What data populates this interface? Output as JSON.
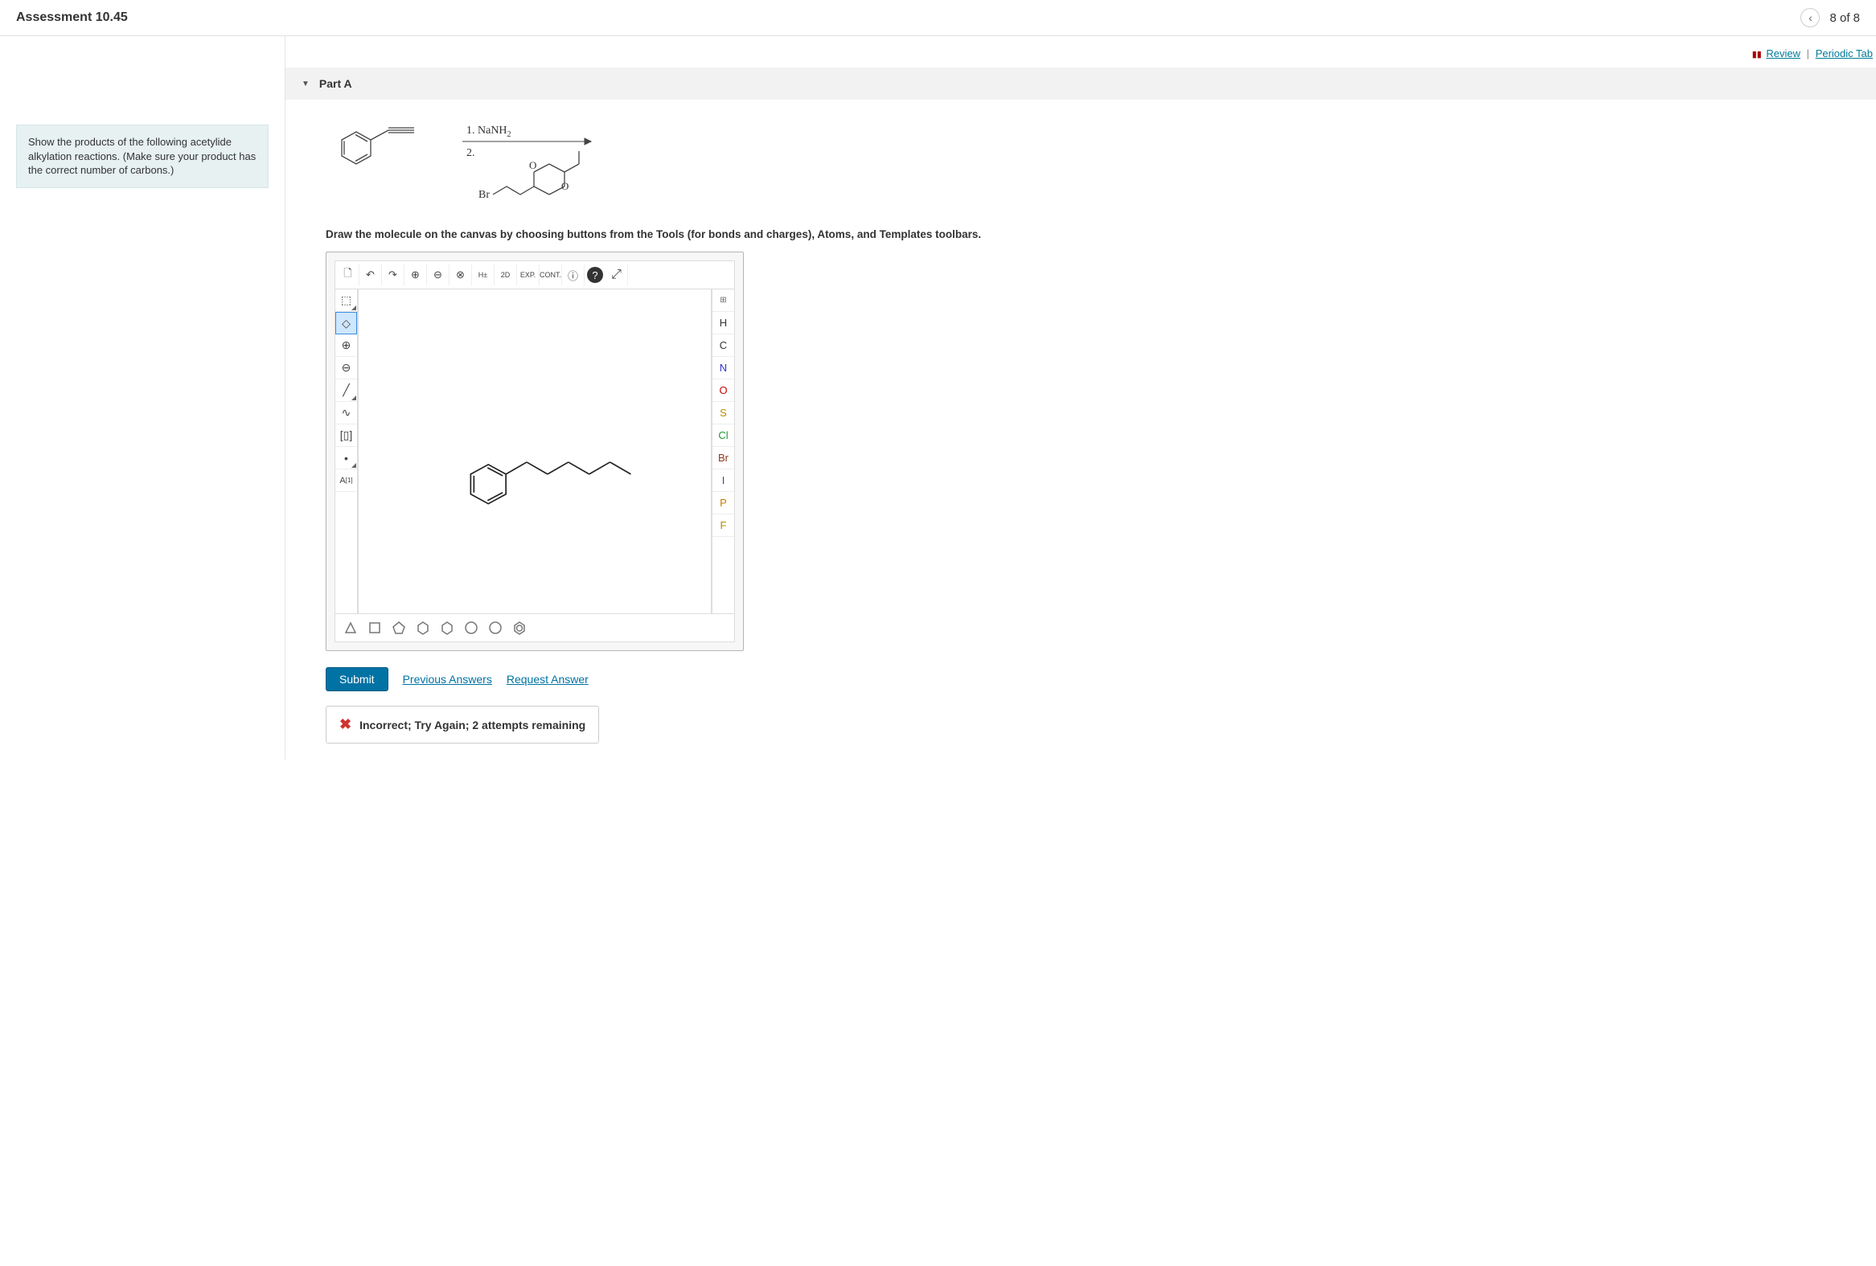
{
  "header": {
    "title": "Assessment 10.45",
    "page_indicator": "8 of 8"
  },
  "review_bar": {
    "review": "Review",
    "periodic": "Periodic Tab"
  },
  "prompt": "Show the products of the following acetylide alkylation reactions. (Make sure your product has the correct number of carbons.)",
  "part": {
    "label": "Part A"
  },
  "reaction": {
    "step1": "1. NaNH",
    "step1_sub": "2",
    "step2": "2.",
    "br_label": "Br",
    "o_label1": "O",
    "o_label2": "O"
  },
  "instruction": "Draw the molecule on the canvas by choosing buttons from the Tools (for bonds and charges), Atoms, and Templates toolbars.",
  "top_toolbar": {
    "new": "🗋",
    "undo": "↶",
    "redo": "↷",
    "zoom_in": "⊕",
    "zoom_out": "⊖",
    "zoom_fit": "⊗",
    "h_toggle": "H±",
    "view_2d": "2D",
    "exp": "EXP.",
    "cont": "CONT.",
    "info": "ⓘ",
    "help": "?",
    "fullscreen": "⤢"
  },
  "left_tools": {
    "select": "⬚",
    "eraser": "◇",
    "plus": "⊕",
    "minus": "⊖",
    "single": "╱",
    "chain": "∿",
    "bracket": "[▯]",
    "dot": "•",
    "atom_label": "A"
  },
  "atom_buttons": [
    {
      "label": "H",
      "color": "#333"
    },
    {
      "label": "C",
      "color": "#333"
    },
    {
      "label": "N",
      "color": "#3333cc"
    },
    {
      "label": "O",
      "color": "#cc0000"
    },
    {
      "label": "S",
      "color": "#b58b00"
    },
    {
      "label": "Cl",
      "color": "#1a9933"
    },
    {
      "label": "Br",
      "color": "#8b3a1a"
    },
    {
      "label": "I",
      "color": "#6b2d8b"
    },
    {
      "label": "P",
      "color": "#cc7a00"
    },
    {
      "label": "F",
      "color": "#b58b00"
    }
  ],
  "actions": {
    "submit": "Submit",
    "previous": "Previous Answers",
    "request": "Request Answer"
  },
  "feedback": "Incorrect; Try Again; 2 attempts remaining"
}
